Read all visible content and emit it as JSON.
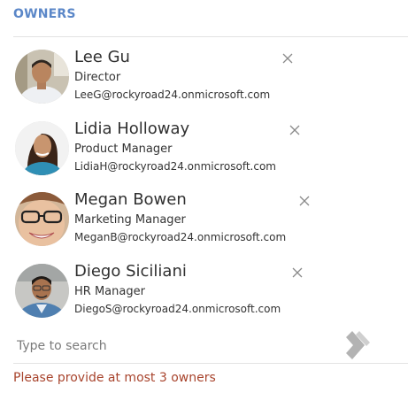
{
  "section": {
    "title": "OWNERS"
  },
  "owners": [
    {
      "name": "Lee Gu",
      "title": "Director",
      "email": "LeeG@rockyroad24.onmicrosoft.com"
    },
    {
      "name": "Lidia Holloway",
      "title": "Product Manager",
      "email": "LidiaH@rockyroad24.onmicrosoft.com"
    },
    {
      "name": "Megan Bowen",
      "title": "Marketing Manager",
      "email": "MeganB@rockyroad24.onmicrosoft.com"
    },
    {
      "name": "Diego Siciliani",
      "title": "HR Manager",
      "email": "DiegoS@rockyroad24.onmicrosoft.com"
    }
  ],
  "search": {
    "placeholder": "Type to search",
    "value": ""
  },
  "validation": {
    "message": "Please provide at most 3 owners"
  },
  "colors": {
    "title": "#5b87c8",
    "error": "#a8442d",
    "divider": "#e3e3e3"
  }
}
